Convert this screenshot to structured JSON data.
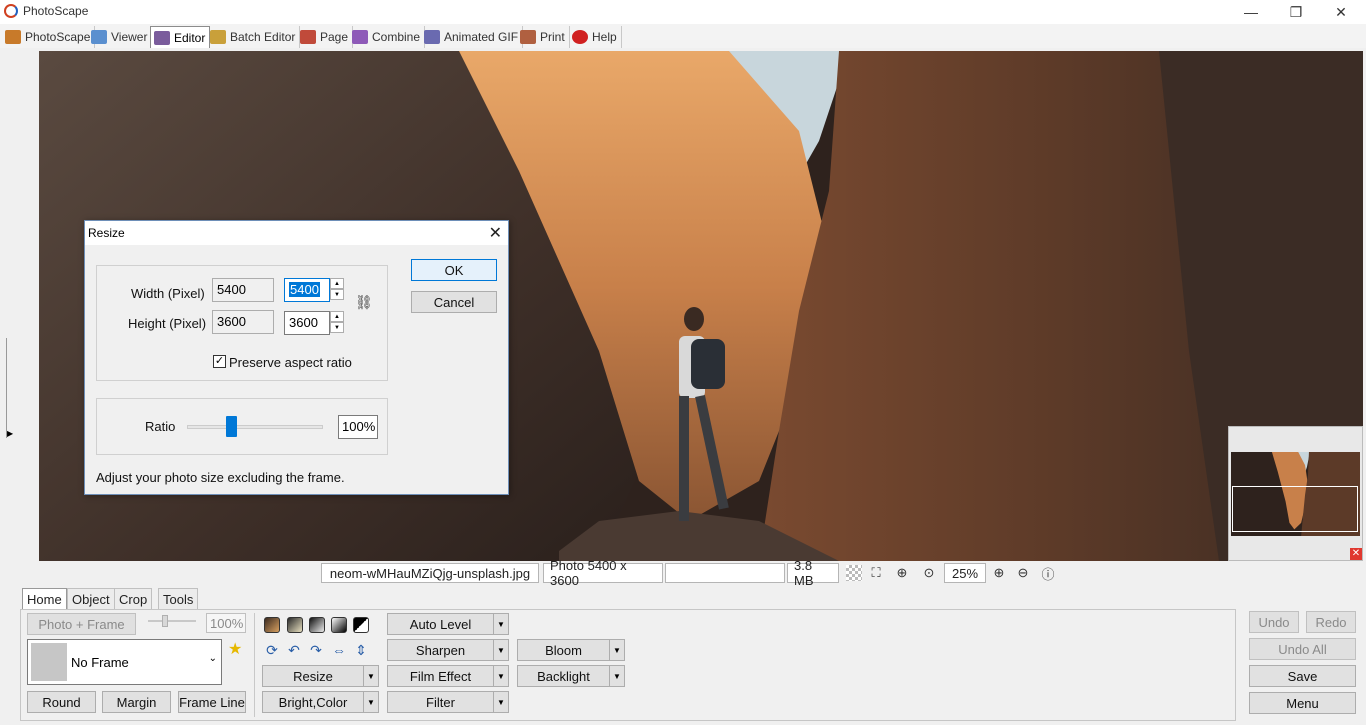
{
  "app": {
    "title": "PhotoScape",
    "window_controls": {
      "minimize": "—",
      "restore": "❐",
      "close": "✕"
    }
  },
  "menu_tabs": [
    {
      "label": "PhotoScape",
      "icon": "photoscape-icon",
      "color": "#c87a2a"
    },
    {
      "label": "Viewer",
      "icon": "viewer-icon",
      "color": "#5a8fcf"
    },
    {
      "label": "Editor",
      "icon": "editor-icon",
      "color": "#7a5c9c",
      "active": true
    },
    {
      "label": "Batch Editor",
      "icon": "batch-editor-icon",
      "color": "#c9a03a"
    },
    {
      "label": "Page",
      "icon": "page-icon",
      "color": "#c04a3a"
    },
    {
      "label": "Combine",
      "icon": "combine-icon",
      "color": "#8e5ab8"
    },
    {
      "label": "Animated GIF",
      "icon": "animated-gif-icon",
      "color": "#6a6ab0"
    },
    {
      "label": "Print",
      "icon": "print-icon",
      "color": "#b06040"
    },
    {
      "label": "Help",
      "icon": "help-icon",
      "color": "#d02020"
    }
  ],
  "status": {
    "filename": "neom-wMHauMZiQjg-unsplash.jpg",
    "photo_size": "Photo 5400 x 3600",
    "extra": "",
    "file_size": "3.8 MB",
    "zoom": "25%"
  },
  "bottom_tabs": [
    "Home",
    "Object",
    "Crop",
    "Tools"
  ],
  "home": {
    "photo_frame_label": "Photo + Frame",
    "frame_percent": "100%",
    "frame_select": "No Frame",
    "round_label": "Round",
    "margin_label": "Margin",
    "frame_line_label": "Frame Line",
    "resize_label": "Resize",
    "bright_color_label": "Bright,Color",
    "auto_level_label": "Auto Level",
    "sharpen_label": "Sharpen",
    "film_effect_label": "Film Effect",
    "filter_label": "Filter",
    "bloom_label": "Bloom",
    "backlight_label": "Backlight"
  },
  "right_actions": {
    "undo": "Undo",
    "redo": "Redo",
    "undo_all": "Undo All",
    "save": "Save",
    "menu": "Menu"
  },
  "resize_dialog": {
    "title": "Resize",
    "width_label": "Width (Pixel)",
    "height_label": "Height (Pixel)",
    "orig_width": "5400",
    "orig_height": "3600",
    "new_width": "5400",
    "new_height": "3600",
    "preserve_label": "Preserve aspect ratio",
    "preserve_checked": true,
    "ratio_label": "Ratio",
    "ratio_value": "100%",
    "ratio_slider_level": 0.3,
    "hint": "Adjust your photo size excluding the frame.",
    "ok_label": "OK",
    "cancel_label": "Cancel"
  }
}
